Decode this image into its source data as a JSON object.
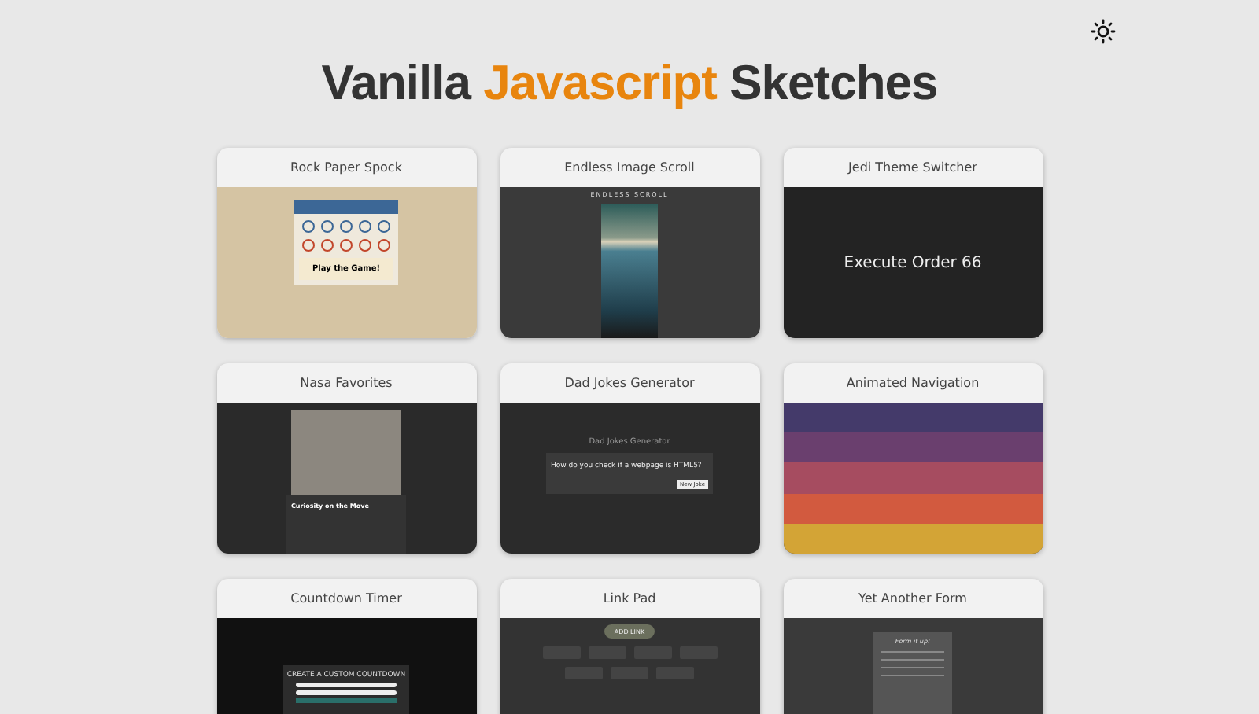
{
  "header": {
    "title_parts": [
      {
        "text": "Vanilla",
        "accent": false
      },
      {
        "text": "Javascript",
        "accent": true
      },
      {
        "text": "Sketches",
        "accent": false
      }
    ]
  },
  "sketches": [
    {
      "title": "Rock Paper Spock",
      "preview": {
        "kind": "rps",
        "texts": [
          "Play the Game!"
        ]
      }
    },
    {
      "title": "Endless Image Scroll",
      "preview": {
        "kind": "scroll",
        "texts": [
          "ENDLESS SCROLL"
        ]
      }
    },
    {
      "title": "Jedi Theme Switcher",
      "preview": {
        "kind": "jedi",
        "texts": [
          "Execute Order 66"
        ]
      }
    },
    {
      "title": "Nasa Favorites",
      "preview": {
        "kind": "nasa",
        "texts": [
          "Curiosity on the Move"
        ]
      }
    },
    {
      "title": "Dad Jokes Generator",
      "preview": {
        "kind": "jokes",
        "texts": [
          "Dad Jokes Generator",
          "How do you check if a webpage is HTML5?",
          "New Joke"
        ]
      }
    },
    {
      "title": "Animated Navigation",
      "preview": {
        "kind": "nav"
      }
    },
    {
      "title": "Countdown Timer",
      "preview": {
        "kind": "countdown",
        "texts": [
          "CREATE A CUSTOM COUNTDOWN"
        ]
      }
    },
    {
      "title": "Link Pad",
      "preview": {
        "kind": "linkpad",
        "texts": [
          "ADD LINK"
        ]
      }
    },
    {
      "title": "Yet Another Form",
      "preview": {
        "kind": "form",
        "texts": [
          "Form it up!"
        ]
      }
    }
  ]
}
